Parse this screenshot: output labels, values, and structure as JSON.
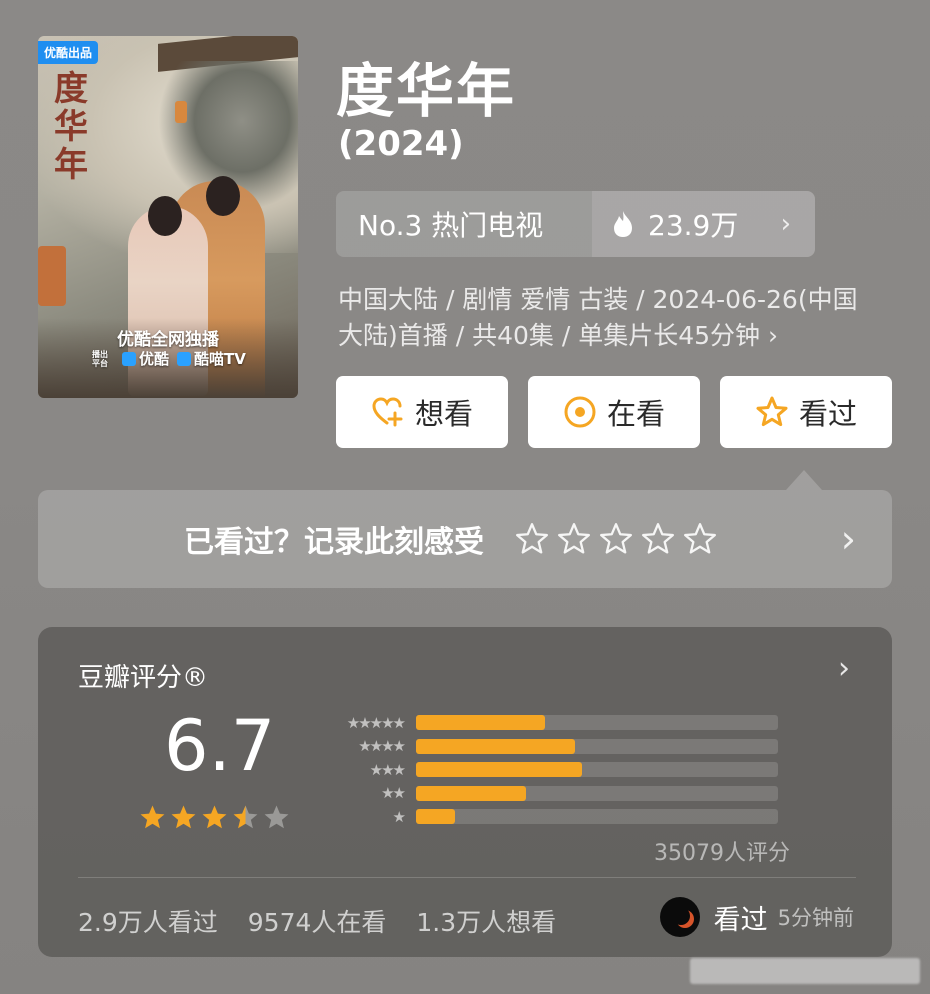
{
  "poster": {
    "badge": "优酷出品",
    "vertical_title": "度华年",
    "exclusive": "优酷全网独播",
    "platform_tag": "播出平台",
    "platform1": "优酷",
    "platform2": "酷喵TV"
  },
  "movie": {
    "title": "度华年",
    "year": "(2024)"
  },
  "rank": {
    "label": "No.3 热门电视",
    "heat": "23.9万"
  },
  "meta": {
    "text": "中国大陆 / 剧情 爱情 古装 / 2024-06-26(中国大陆)首播 / 共40集 / 单集片长45分钟 ›"
  },
  "actions": {
    "want": "想看",
    "watching": "在看",
    "watched": "看过"
  },
  "record": {
    "prompt": "已看过？记录此刻感受",
    "star_count": 5
  },
  "rating": {
    "title": "豆瓣评分®",
    "score": "6.7",
    "score_stars": 3.5,
    "count": "35079人评分",
    "stats": [
      "2.9万人看过",
      "9574人在看",
      "1.3万人想看"
    ],
    "my_status": "看过",
    "my_time": "5分钟前"
  },
  "chart_data": {
    "type": "bar",
    "categories": [
      "5星",
      "4星",
      "3星",
      "2星",
      "1星"
    ],
    "values": [
      21.4,
      26.3,
      27.5,
      18.3,
      6.5
    ],
    "unit": "%"
  },
  "colors": {
    "accent": "#f5a623",
    "badge": "#1f8ef0"
  }
}
